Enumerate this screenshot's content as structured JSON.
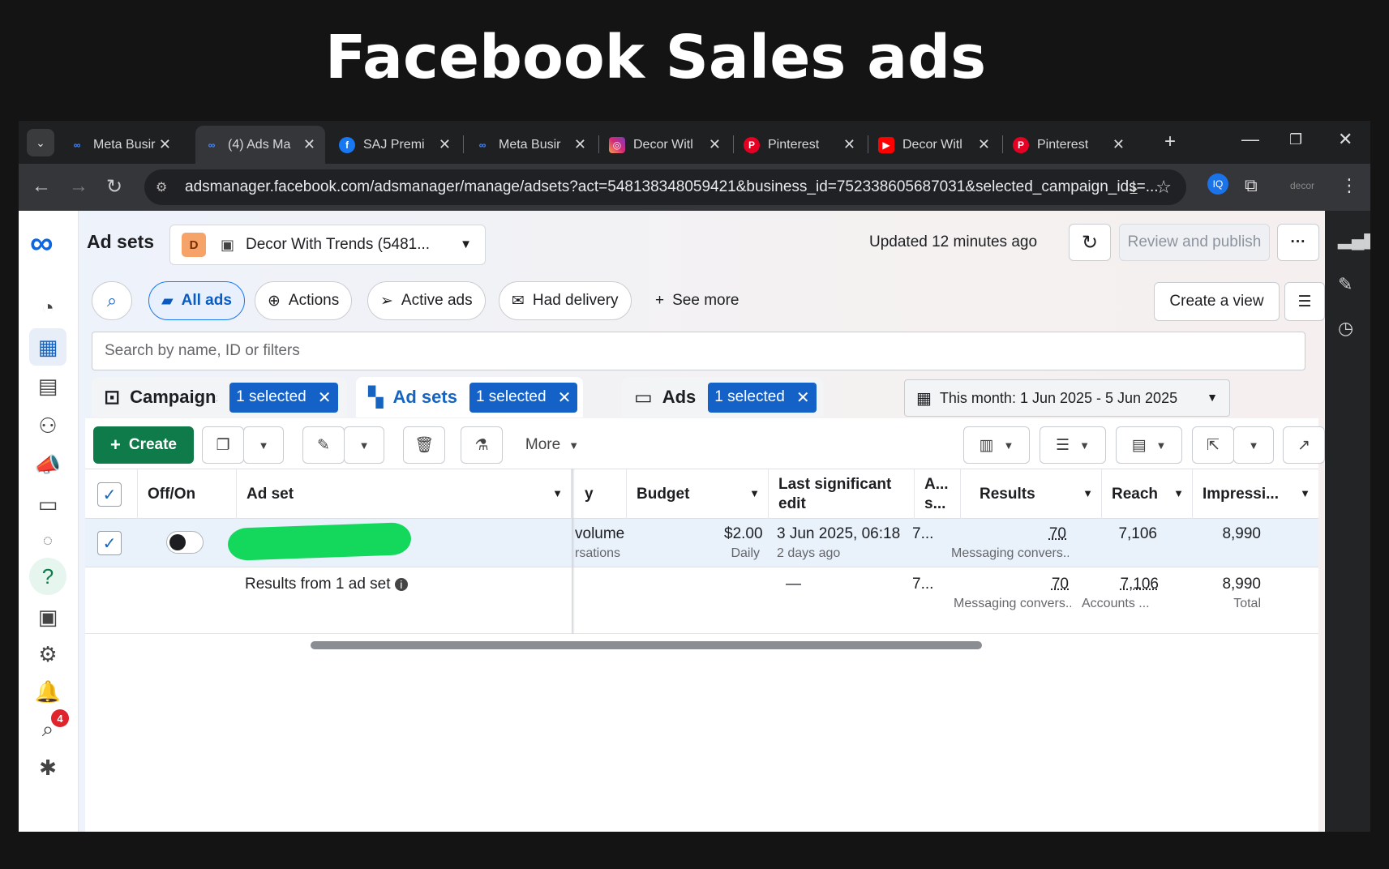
{
  "headline": "Facebook Sales ads",
  "browser": {
    "tabs": [
      {
        "title": "Meta Busir",
        "icon": "meta-icon"
      },
      {
        "title": "(4) Ads Ma",
        "icon": "meta-icon",
        "active": true
      },
      {
        "title": "SAJ Premi",
        "icon": "facebook-icon"
      },
      {
        "title": "Meta Busir",
        "icon": "meta-icon"
      },
      {
        "title": "Decor Witl",
        "icon": "instagram-icon"
      },
      {
        "title": "Pinterest",
        "icon": "pinterest-icon"
      },
      {
        "title": "Decor Witl",
        "icon": "youtube-icon"
      },
      {
        "title": "Pinterest",
        "icon": "pinterest-icon"
      }
    ],
    "url": "adsmanager.facebook.com/adsmanager/manage/adsets?act=548138348059421&business_id=752338605687031&selected_campaign_ids=..."
  },
  "header": {
    "title": "Ad sets",
    "account_initial": "D",
    "account_name": "Decor With Trends (5481...",
    "updated": "Updated 12 minutes ago",
    "review_publish": "Review and publish",
    "more": "···"
  },
  "filters": {
    "chips": [
      "All ads",
      "Actions",
      "Active ads",
      "Had delivery"
    ],
    "see_more": "See more",
    "create_view": "Create a view",
    "search_placeholder": "Search by name, ID or filters"
  },
  "levels": {
    "campaigns": {
      "label": "Campaigns",
      "selected": "1 selected"
    },
    "adsets": {
      "label": "Ad sets",
      "selected": "1 selected"
    },
    "ads": {
      "label": "Ads",
      "selected": "1 selected"
    }
  },
  "daterange": "This month: 1 Jun 2025 - 5 Jun 2025",
  "toolbar": {
    "create": "Create",
    "more": "More"
  },
  "table": {
    "headers": {
      "offon": "Off/On",
      "adset": "Ad set",
      "y": "y",
      "budget": "Budget",
      "last_edit": "Last significant edit",
      "a": "A... s...",
      "results": "Results",
      "reach": "Reach",
      "impressions": "Impressi..."
    },
    "row": {
      "partial1": "volume",
      "partial2": "rsations",
      "budget": "$2.00",
      "budget_sub": "Daily",
      "last_edit": "3 Jun 2025, 06:18",
      "last_edit_sub": "2 days ago",
      "a": "7...",
      "results": "70",
      "results_sub": "Messaging convers...",
      "reach": "7,106",
      "impressions": "8,990"
    },
    "totals": {
      "label": "Results from 1 ad set",
      "last_edit": "—",
      "a": "7...",
      "results": "70",
      "results_sub": "Messaging convers...",
      "reach": "7,106",
      "reach_sub": "Accounts ...",
      "impressions": "8,990",
      "impressions_sub": "Total"
    }
  },
  "notifications": "4",
  "colors": {
    "accent": "#1877f2",
    "create": "#0f7a4a",
    "selected_pill": "#1462c8",
    "blob": "#14d85b"
  }
}
